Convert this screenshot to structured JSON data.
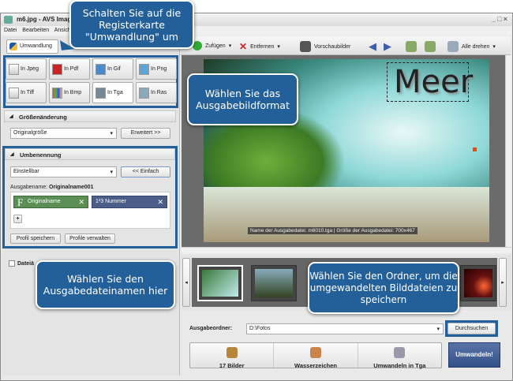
{
  "window": {
    "title": "m6.jpg - AVS Image",
    "controls": [
      "_",
      "□",
      "×"
    ]
  },
  "menu": [
    "Datei",
    "Bearbeiten",
    "Ansicht"
  ],
  "left": {
    "tab": "Umwandlung",
    "formats": [
      "In Jpeg",
      "In Pdf",
      "In Gif",
      "In Png",
      "In Tiff",
      "In Bmp",
      "In Tga",
      "In Ras"
    ],
    "resize": {
      "header": "Größenänderung",
      "value": "Originalgröße",
      "button": "Erweitert >>"
    },
    "rename": {
      "header": "Umbenennung",
      "value": "Einstellbar",
      "button": "<< Einfach",
      "output_label": "Ausgabename:",
      "output_value": "Originalname001",
      "token1": "Originalname",
      "token2": "Nummer",
      "token2_icon": "1²3",
      "add": "+",
      "save": "Profil speichern",
      "manage": "Profile verwalten"
    },
    "checkbox": "Dateiä"
  },
  "toolbar": {
    "add": "Zufügen",
    "remove": "Entfernen",
    "thumbs": "Vorschaubilder",
    "rotate_all": "Alle drehen"
  },
  "preview": {
    "overlay_text": "Meer",
    "caption": "Name der Ausgabedatei: m6010.tga | Größe der Ausgabedatei: 700x467"
  },
  "output": {
    "label": "Ausgabeordner:",
    "value": "D:\\Fotos",
    "browse": "Durchsuchen"
  },
  "steps": [
    "17 Bilder",
    "Wasserzeichen",
    "Umwandeln in Tga"
  ],
  "convert": "Umwandeln!",
  "callouts": {
    "tab": "Schalten Sie auf die Registerkarte \"Umwandlung\" um",
    "format": "Wählen Sie das Ausgabebildformat",
    "name": "Wählen Sie den Ausgabedateinamen hier",
    "folder": "Wählen Sie den Ordner, um die umgewandelten Bilddateien zu speichern"
  },
  "colors": {
    "callout": "#23609a",
    "convert": "#3c5a8c",
    "highlight": "#23609a"
  }
}
